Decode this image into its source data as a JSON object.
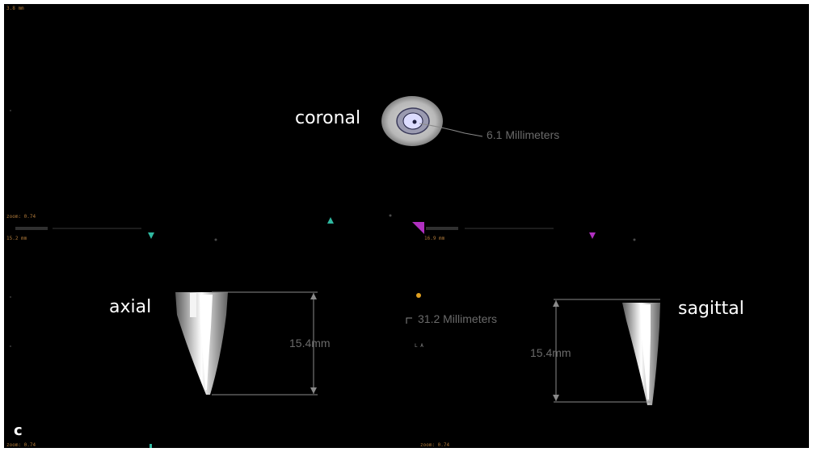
{
  "views": {
    "coronal": "coronal",
    "axial": "axial",
    "sagittal": "sagittal"
  },
  "measurements": {
    "coronal_width": "6.1 Millimeters",
    "central": "31.2 Millimeters",
    "axial_length": "15.4mm",
    "sagittal_length": "15.4mm"
  },
  "panel_letter": "c",
  "viewer_overlay": {
    "top_left_scale": "3.8 mm",
    "zoom_left": "zoom: 0.74",
    "zoom_right": "zoom: 0.74",
    "slice_left": "15.2 mm",
    "slice_right": "16.9 mm",
    "bottom_left_zoom": "zoom: 0.74",
    "bottom_right_zoom": "zoom: 0.74",
    "ruler_mark": "L A"
  },
  "colors": {
    "background": "#000000",
    "label": "#ffffff",
    "measurement": "#6a6a6a",
    "marker_cyan": "#2fb8a0",
    "marker_magenta": "#b030c0",
    "marker_orange": "#e0a020"
  }
}
